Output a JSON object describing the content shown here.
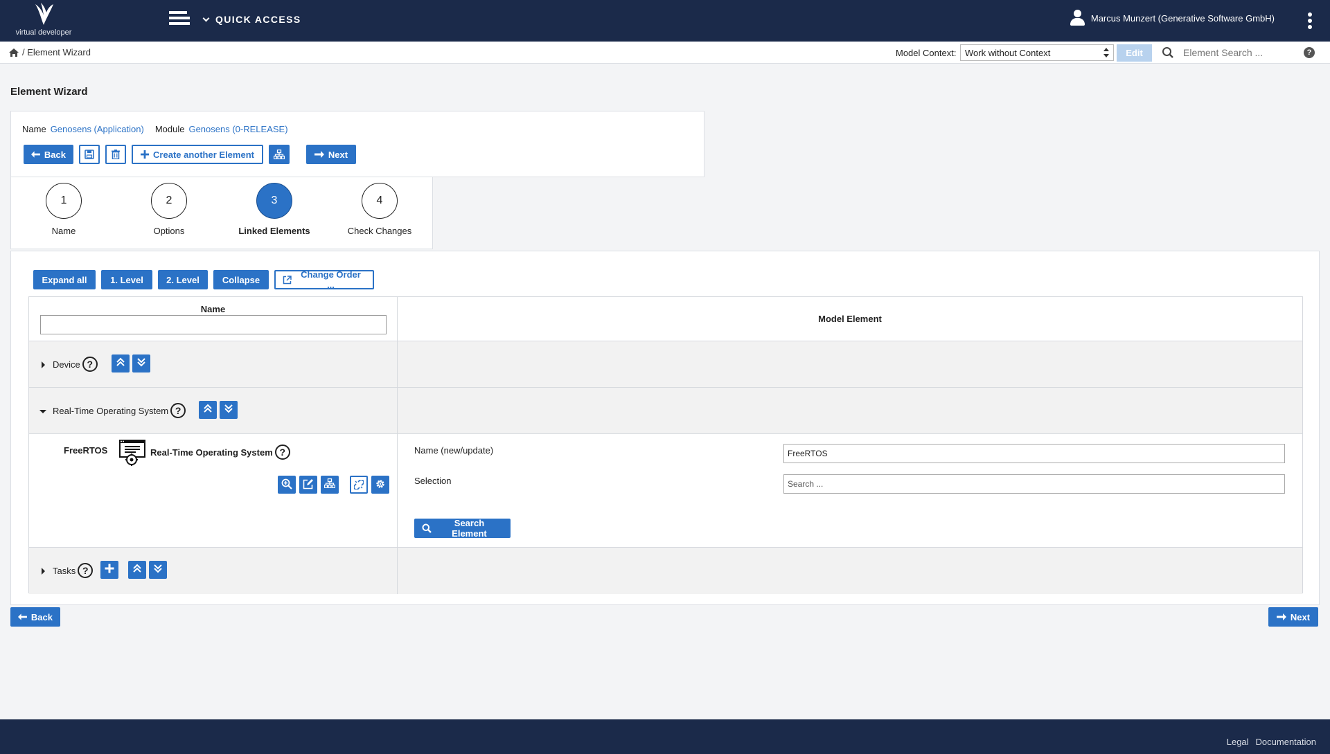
{
  "header": {
    "logo_text": "virtual developer",
    "quick_access": "QUICK ACCESS",
    "user_name": "Marcus Munzert (Generative Software GmbH)"
  },
  "subbar": {
    "breadcrumb": "/ Element Wizard",
    "model_context_label": "Model Context:",
    "model_context_value": "Work without Context",
    "edit_label": "Edit",
    "search_placeholder": "Element Search ..."
  },
  "page": {
    "title": "Element Wizard"
  },
  "info": {
    "name_label": "Name",
    "name_value": "Genosens (Application)",
    "module_label": "Module",
    "module_value": "Genosens (0-RELEASE)",
    "back_label": "Back",
    "create_label": "Create another Element",
    "next_label": "Next"
  },
  "steps": [
    {
      "number": "1",
      "label": "Name",
      "active": false
    },
    {
      "number": "2",
      "label": "Options",
      "active": false
    },
    {
      "number": "3",
      "label": "Linked Elements",
      "active": true
    },
    {
      "number": "4",
      "label": "Check Changes",
      "active": false
    }
  ],
  "toolbar": {
    "expand_all": "Expand all",
    "level1": "1. Level",
    "level2": "2. Level",
    "collapse": "Collapse",
    "change_order": "Change Order ..."
  },
  "table": {
    "col_name": "Name",
    "col_model": "Model Element",
    "groups": {
      "device": "Device",
      "rtos": "Real-Time Operating System",
      "tasks": "Tasks"
    },
    "item": {
      "name": "FreeRTOS",
      "type": "Real-Time Operating System",
      "name_field_label": "Name (new/update)",
      "name_field_value": "FreeRTOS",
      "selection_label": "Selection",
      "selection_placeholder": "Search ...",
      "search_button": "Search Element"
    }
  },
  "bottom": {
    "back_label": "Back",
    "next_label": "Next"
  },
  "footer": {
    "legal": "Legal",
    "documentation": "Documentation"
  },
  "colors": {
    "primary": "#2b72c6",
    "header_bg": "#1b2a4a"
  }
}
